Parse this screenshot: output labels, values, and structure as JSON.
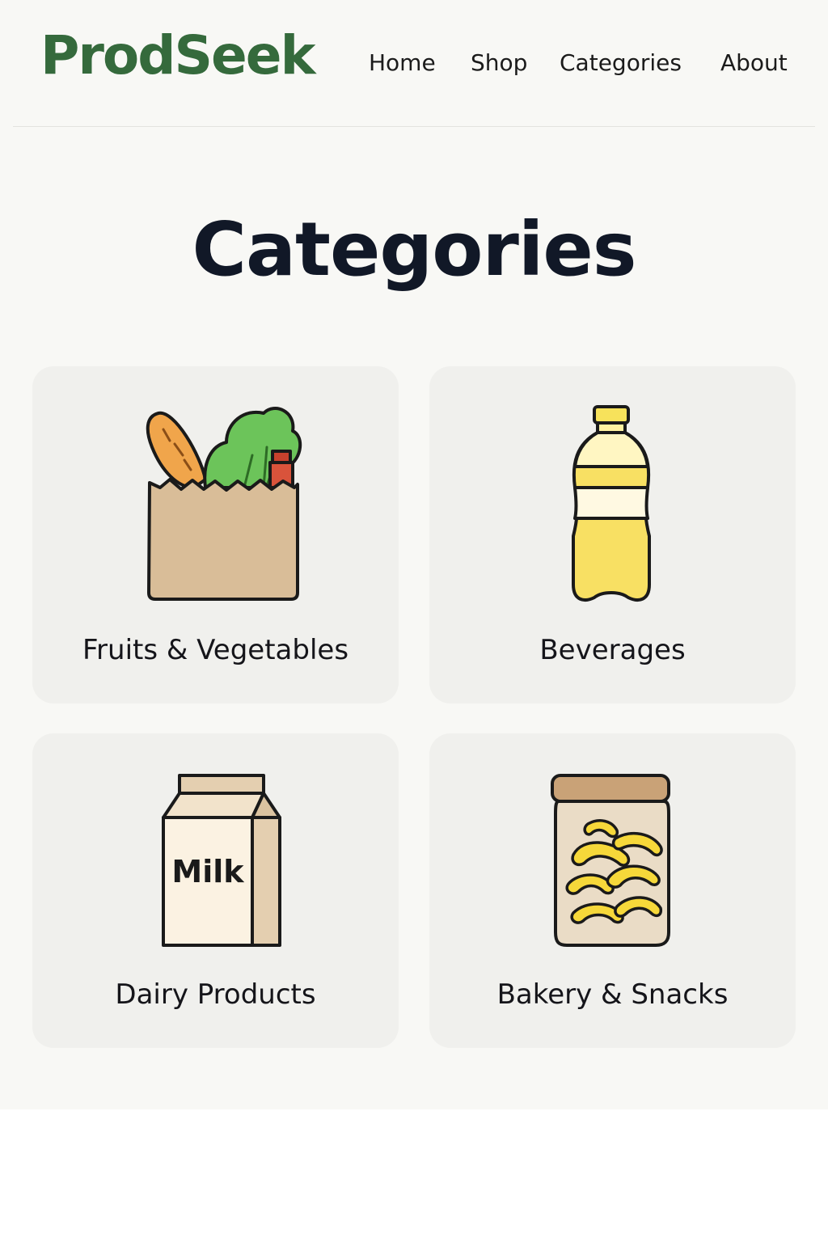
{
  "header": {
    "logo": "ProdSeek",
    "nav": [
      {
        "label": "Home"
      },
      {
        "label": "Shop"
      },
      {
        "label": "Categories"
      },
      {
        "label": "About"
      }
    ]
  },
  "main": {
    "title": "Categories",
    "categories": [
      {
        "label": "Fruits & Vegetables",
        "icon": "grocery-bag-icon"
      },
      {
        "label": "Beverages",
        "icon": "bottle-icon"
      },
      {
        "label": "Dairy Products",
        "icon": "milk-carton-icon",
        "icon_text": "Milk"
      },
      {
        "label": "Bakery & Snacks",
        "icon": "snack-jar-icon"
      }
    ]
  },
  "colors": {
    "brand": "#356a3c",
    "page_background": "#f8f8f5",
    "card_background": "#f0f0ed",
    "text": "#111827"
  }
}
